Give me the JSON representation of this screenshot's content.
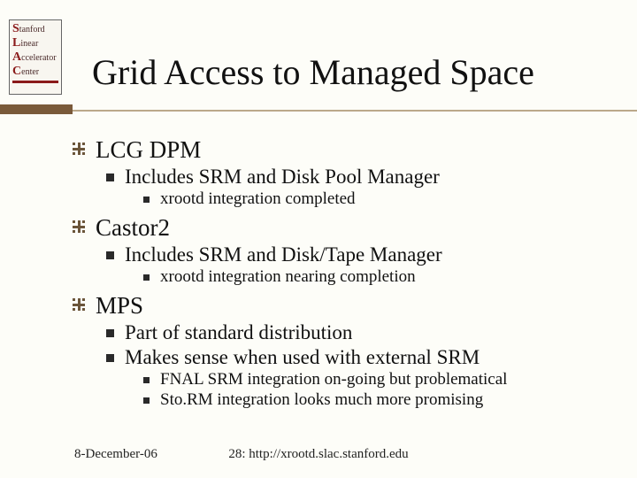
{
  "logo": {
    "l1": "Stanford",
    "l2": "Linear",
    "l3": "Accelerator",
    "l4": "Center"
  },
  "title": "Grid Access to Managed Space",
  "bullets": {
    "b1": "LCG DPM",
    "b1_1": "Includes SRM and Disk Pool Manager",
    "b1_1_1": "xrootd integration completed",
    "b2": "Castor2",
    "b2_1": "Includes SRM and Disk/Tape Manager",
    "b2_1_1": "xrootd integration nearing completion",
    "b3": "MPS",
    "b3_1": "Part of standard distribution",
    "b3_2": "Makes sense when used with external SRM",
    "b3_2_1": "FNAL SRM integration on-going but problematical",
    "b3_2_2": "Sto.RM integration looks much more promising"
  },
  "footer": {
    "date": "8-December-06",
    "page": "28: http://xrootd.slac.stanford.edu"
  }
}
